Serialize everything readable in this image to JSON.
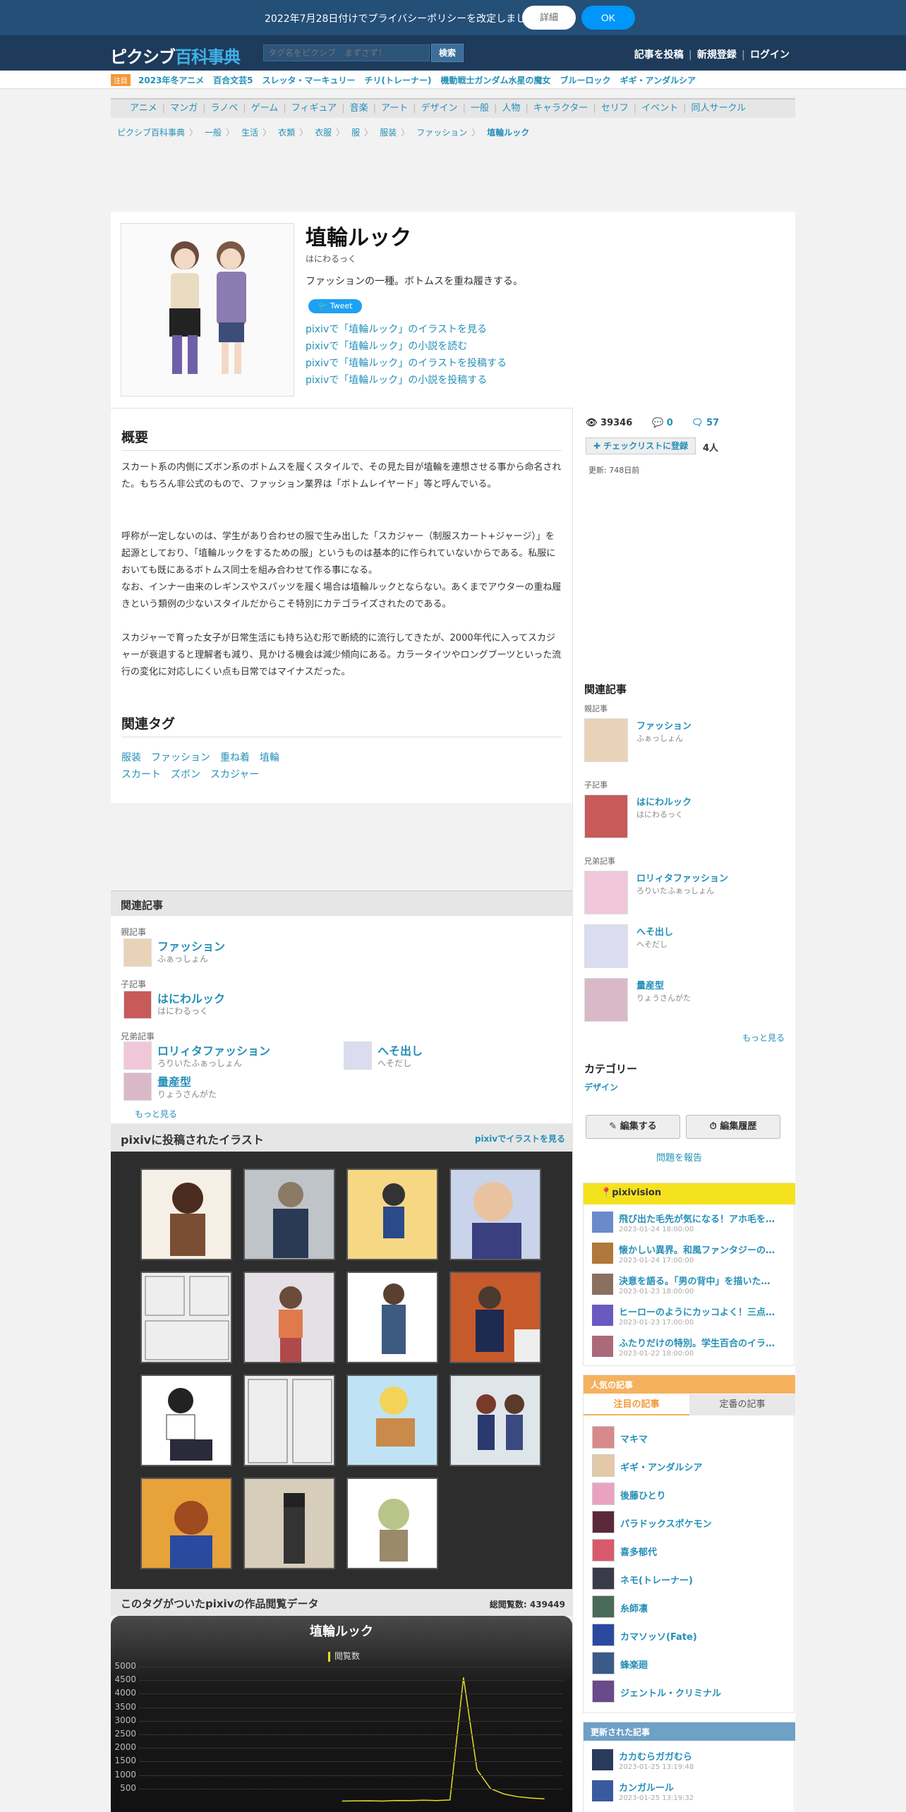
{
  "notice": {
    "text": "2022年7月28日付けでプライバシーポリシーを改定しました",
    "detail_label": "詳細",
    "ok_label": "OK"
  },
  "header": {
    "logo_a": "ピクシブ",
    "logo_b": "百科事典",
    "search_placeholder": "タグ名をピクシブ　まずさず！",
    "search_button": "検索",
    "nav": [
      "記事を投稿",
      "新規登録",
      "ログイン"
    ]
  },
  "trending": {
    "badge": "注目",
    "items": [
      "2023年冬アニメ",
      "百合文芸5",
      "スレッタ・マーキュリー",
      "チリ(トレーナー)",
      "機動戦士ガンダム水星の魔女",
      "ブルーロック",
      "ギギ・アンダルシア"
    ]
  },
  "categories": [
    "アニメ",
    "マンガ",
    "ラノベ",
    "ゲーム",
    "フィギュア",
    "音楽",
    "アート",
    "デザイン",
    "一般",
    "人物",
    "キャラクター",
    "セリフ",
    "イベント",
    "同人サークル"
  ],
  "breadcrumb": [
    "ピクシブ百科事典",
    "一般",
    "生活",
    "衣類",
    "衣服",
    "服",
    "服装",
    "ファッション",
    "埴輪ルック"
  ],
  "article": {
    "title": "埴輪ルック",
    "reading": "はにわるっく",
    "summary": "ファッションの一種。ボトムスを重ね履きする。",
    "tweet_label": "Tweet",
    "pixiv_links": [
      "pixivで「埴輪ルック」のイラストを見る",
      "pixivで「埴輪ルック」の小説を読む",
      "pixivで「埴輪ルック」のイラストを投稿する",
      "pixivで「埴輪ルック」の小説を投稿する"
    ],
    "overview_heading": "概要",
    "para1": "スカート系の内側にズボン系のボトムスを履くスタイルで、その見た目が埴輪を連想させる事から命名された。もちろん非公式のもので、ファッション業界は「ボトムレイヤード」等と呼んでいる。",
    "para2": "呼称が一定しないのは、学生があり合わせの服で生み出した「スカジャー（制服スカート+ジャージ）」を起源としており、「埴輪ルックをするための服」というものは基本的に作られていないからである。私服においても既にあるボトムス同士を組み合わせて作る事になる。",
    "para3": "なお、インナー由来のレギンスやスパッツを履く場合は埴輪ルックとならない。あくまでアウターの重ね履きという類例の少ないスタイルだからこそ特別にカテゴライズされたのである。",
    "para4": "スカジャーで育った女子が日常生活にも持ち込む形で断続的に流行してきたが、2000年代に入ってスカジャーが衰退すると理解者も減り、見かける機会は減少傾向にある。カラータイツやロングブーツといった流行の変化に対応しにくい点も日常ではマイナスだった。",
    "tags_heading": "関連タグ",
    "tags_row1": [
      "服装",
      "ファッション",
      "重ね着",
      "埴輪"
    ],
    "tags_row2": [
      "スカート",
      "ズボン",
      "スカジャー"
    ]
  },
  "stats": {
    "views": "39346",
    "comments": "0",
    "replies": "57",
    "checklist_label": "チェックリストに登録",
    "checklist_count": "4人",
    "updated": "更新: 748日前"
  },
  "related": {
    "heading": "関連記事",
    "parent_label": "親記事",
    "child_label": "子記事",
    "sibling_label": "兄弟記事",
    "parent": {
      "name": "ファッション",
      "reading": "ふぁっしょん"
    },
    "child": {
      "name": "はにわルック",
      "reading": "はにわるっく"
    },
    "siblings": [
      {
        "name": "ロリィタファッション",
        "reading": "ろりいたふぁっしょん"
      },
      {
        "name": "へそ出し",
        "reading": "へそだし"
      },
      {
        "name": "量産型",
        "reading": "りょうさんがた"
      }
    ],
    "more_label": "もっと見る"
  },
  "category_box": {
    "heading": "カテゴリー",
    "value": "デザイン",
    "edit_label": "編集する",
    "history_label": "編集履歴",
    "report_label": "問題を報告"
  },
  "illustrations": {
    "heading": "pixivに投稿されたイラスト",
    "more_label": "pixivでイラストを見る"
  },
  "pixivision": {
    "heading": "pixivision",
    "items": [
      {
        "title": "飛び出た毛先が気になる！アホ毛を…",
        "date": "2023-01-24 18:00:00"
      },
      {
        "title": "懐かしい異界。和風ファンタジーの…",
        "date": "2023-01-24 17:00:00"
      },
      {
        "title": "決意を語る。「男の背中」を描いた…",
        "date": "2023-01-23 18:00:00"
      },
      {
        "title": "ヒーローのようにカッコよく！三点…",
        "date": "2023-01-23 17:00:00"
      },
      {
        "title": "ふたりだけの特別。学生百合のイラ…",
        "date": "2023-01-22 18:00:00"
      }
    ]
  },
  "popular": {
    "heading": "人気の記事",
    "tab_active": "注目の記事",
    "tab_other": "定番の記事",
    "items": [
      "マキマ",
      "ギギ・アンダルシア",
      "後藤ひとり",
      "パラドックスポケモン",
      "喜多郁代",
      "ネモ(トレーナー)",
      "糸師凛",
      "カマソッソ(Fate)",
      "蜂楽廻",
      "ジェントル・クリミナル"
    ]
  },
  "updated_articles": {
    "heading": "更新された記事",
    "items": [
      {
        "title": "カカむらガガむら",
        "date": "2023-01-25 13:19:48"
      },
      {
        "title": "カンガルール",
        "date": "2023-01-25 13:19:32"
      }
    ]
  },
  "graph": {
    "heading": "このタグがついたpixivの作品閲覧データ",
    "total": "総閲覧数: 439449",
    "chart_data": {
      "type": "line",
      "title": "埴輪ルック",
      "series": [
        {
          "name": "閲覧数",
          "values": [
            40,
            45,
            50,
            40,
            60,
            55,
            70,
            60,
            80,
            4600,
            1200,
            500,
            300,
            200,
            150,
            120
          ]
        }
      ],
      "ylim": [
        0,
        5000
      ],
      "yticks": [
        5000,
        4500,
        4000,
        3500,
        3000,
        2500,
        2000,
        1500,
        1000,
        500
      ],
      "color": "#e0e02a"
    }
  }
}
